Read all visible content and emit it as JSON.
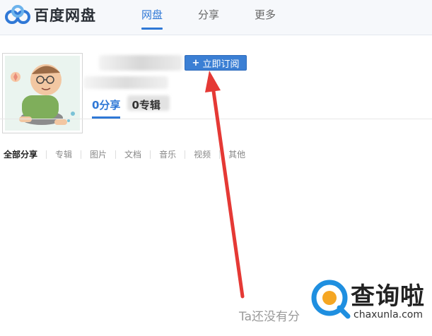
{
  "header": {
    "logo_text": "百度网盘",
    "nav": [
      {
        "label": "网盘",
        "active": true
      },
      {
        "label": "分享",
        "active": false
      },
      {
        "label": "更多",
        "active": false
      }
    ]
  },
  "profile": {
    "subscribe_label": "立即订阅",
    "stats": [
      {
        "label": "0分享",
        "active": true
      },
      {
        "label": "0专辑",
        "active": false
      }
    ]
  },
  "filters": [
    {
      "label": "全部分享",
      "active": true
    },
    {
      "label": "专辑",
      "active": false
    },
    {
      "label": "图片",
      "active": false
    },
    {
      "label": "文档",
      "active": false
    },
    {
      "label": "音乐",
      "active": false
    },
    {
      "label": "视频",
      "active": false
    },
    {
      "label": "其他",
      "active": false
    }
  ],
  "empty_text": "Ta还没有分",
  "watermark": {
    "title": "查询啦",
    "sub": "chaxunla.com"
  },
  "colors": {
    "accent": "#2f78d6",
    "button": "#3b7fd4",
    "arrow": "#e53935"
  }
}
